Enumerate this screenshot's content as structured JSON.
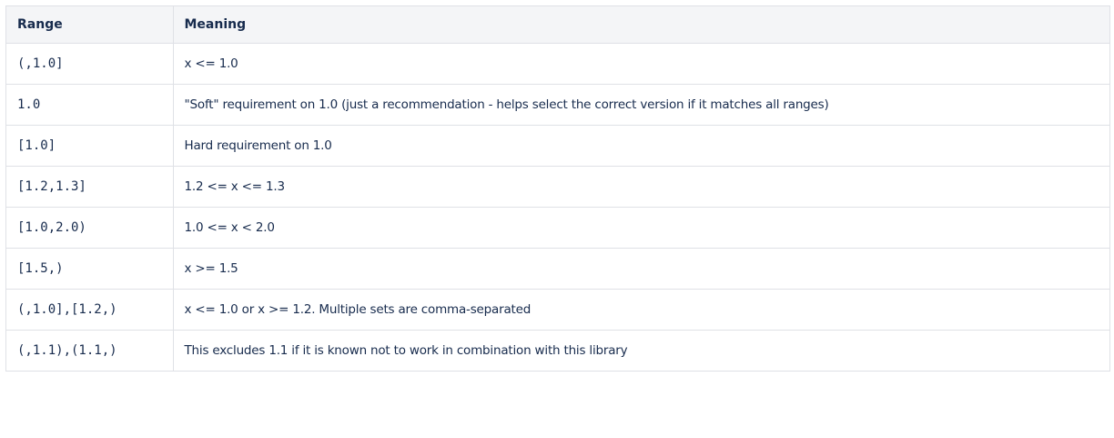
{
  "table": {
    "headers": {
      "range": "Range",
      "meaning": "Meaning"
    },
    "rows": [
      {
        "range": "(,1.0]",
        "meaning": "x <= 1.0"
      },
      {
        "range": "1.0",
        "meaning": "\"Soft\" requirement on 1.0 (just a recommendation - helps select the correct version if it matches all ranges)"
      },
      {
        "range": "[1.0]",
        "meaning": "Hard requirement on 1.0"
      },
      {
        "range": "[1.2,1.3]",
        "meaning": "1.2 <= x <= 1.3"
      },
      {
        "range": "[1.0,2.0)",
        "meaning": "1.0 <= x < 2.0"
      },
      {
        "range": "[1.5,)",
        "meaning": "x >= 1.5"
      },
      {
        "range": "(,1.0],[1.2,)",
        "meaning": "x <= 1.0 or x >= 1.2. Multiple sets are comma-separated"
      },
      {
        "range": "(,1.1),(1.1,)",
        "meaning": "This excludes 1.1 if it is known not to work in combination with this library"
      }
    ]
  }
}
